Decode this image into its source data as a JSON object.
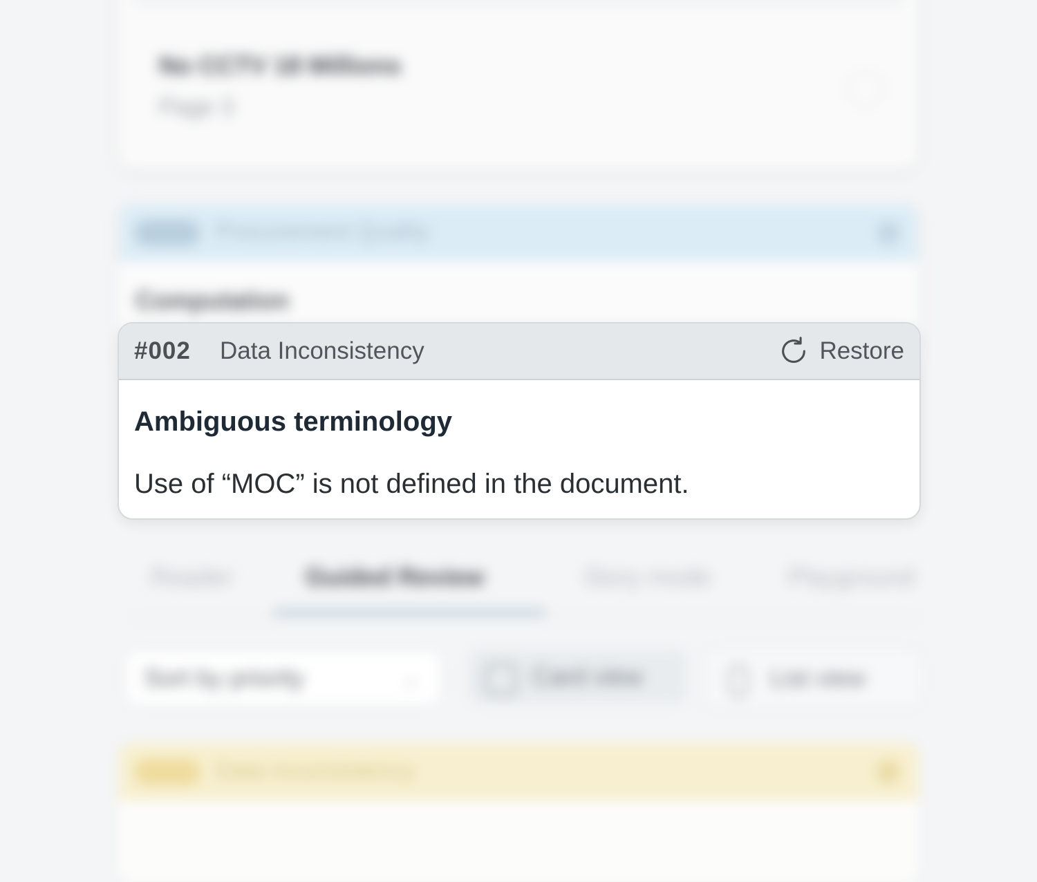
{
  "background": {
    "document_card": {
      "title": "No CCTV 18 Millions",
      "subtitle": "Page 3"
    },
    "issue_card_blue": {
      "badge": "",
      "category": "Procurement Quality",
      "section_title": "Computation"
    },
    "tabs": [
      {
        "label": "Reader"
      },
      {
        "label": "Guided Review"
      },
      {
        "label": "Story mode"
      },
      {
        "label": "Playground"
      }
    ],
    "sort_select": {
      "value": "Sort by priority"
    },
    "view_toggle": {
      "card_label": "Card view",
      "list_label": "List view"
    },
    "issue_card_yellow": {
      "category": "Data Inconsistency"
    }
  },
  "focused_issue": {
    "id": "#002",
    "category": "Data Inconsistency",
    "restore_label": "Restore",
    "restore_icon": "refresh-icon",
    "title": "Ambiguous terminology",
    "description": "Use of “MOC” is not defined in the document."
  },
  "colors": {
    "header_bg": "#e4e8eb",
    "title_text": "#1e2a36",
    "blue_header": "#dcecf6",
    "yellow_header": "#f7efcf"
  }
}
